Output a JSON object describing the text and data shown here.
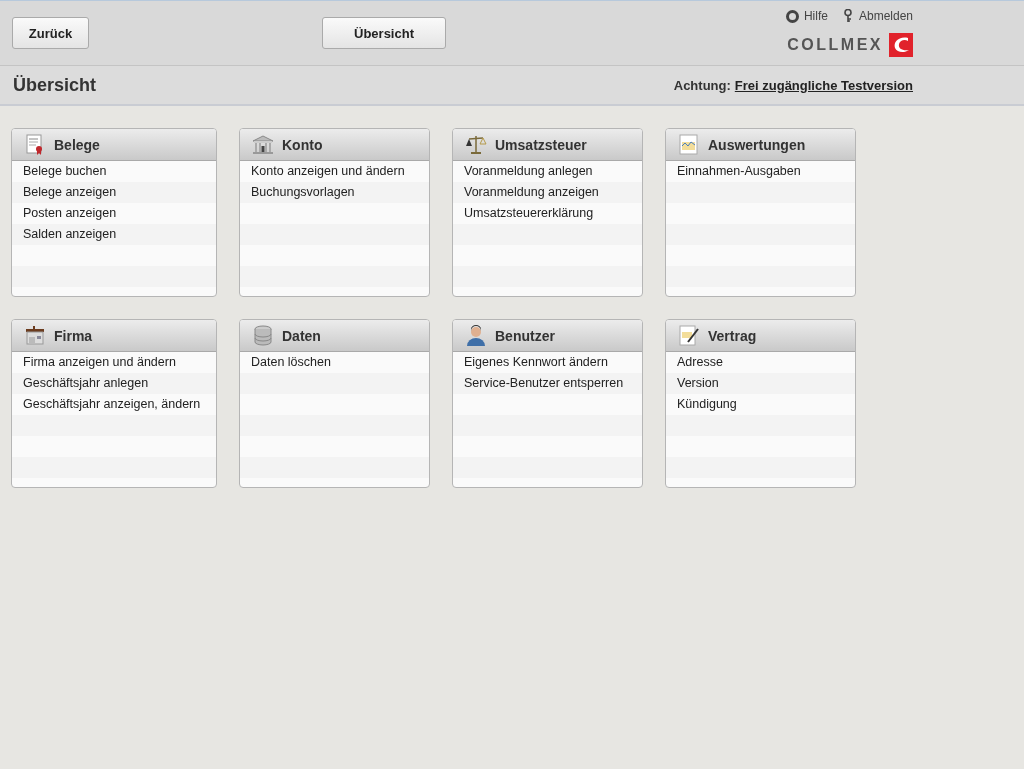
{
  "toolbar": {
    "back_button": "Zurück",
    "overview_button": "Übersicht",
    "help_link": "Hilfe",
    "logout_link": "Abmelden",
    "logo": "COLLMEX"
  },
  "title_bar": {
    "title": "Übersicht",
    "notice_label": "Achtung:",
    "notice_link": "Frei zugängliche Testversion"
  },
  "cards": [
    {
      "title": "Belege",
      "items": [
        "Belege buchen",
        "Belege anzeigen",
        "Posten anzeigen",
        "Salden anzeigen"
      ]
    },
    {
      "title": "Konto",
      "items": [
        "Konto anzeigen und ändern",
        "Buchungsvorlagen"
      ]
    },
    {
      "title": "Umsatzsteuer",
      "items": [
        "Voranmeldung anlegen",
        "Voranmeldung anzeigen",
        "Umsatzsteuererklärung"
      ]
    },
    {
      "title": "Auswertungen",
      "items": [
        "Einnahmen-Ausgaben"
      ]
    },
    {
      "title": "Firma",
      "items": [
        "Firma anzeigen und ändern",
        "Geschäftsjahr anlegen",
        "Geschäftsjahr anzeigen, ändern"
      ]
    },
    {
      "title": "Daten",
      "items": [
        "Daten löschen"
      ]
    },
    {
      "title": "Benutzer",
      "items": [
        "Eigenes Kennwort ändern",
        "Service-Benutzer entsperren"
      ]
    },
    {
      "title": "Vertrag",
      "items": [
        "Adresse",
        "Version",
        "Kündigung"
      ]
    }
  ]
}
